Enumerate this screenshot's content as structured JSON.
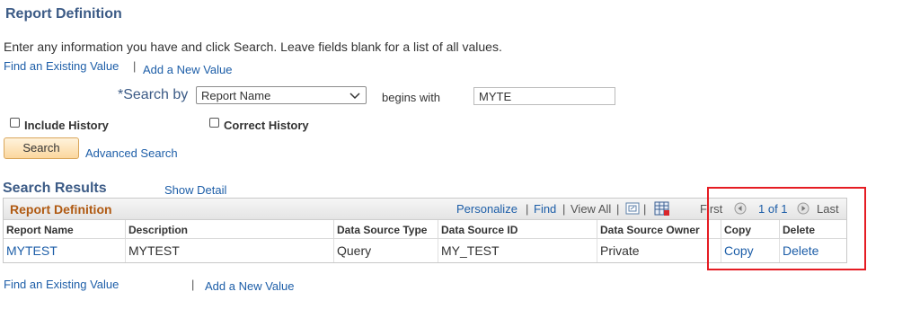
{
  "page": {
    "title": "Report Definition",
    "instructions": "Enter any information you have and click Search. Leave fields blank for a list of all values.",
    "find_existing": "Find an Existing Value",
    "separator": "|",
    "add_new": "Add a New Value"
  },
  "search": {
    "search_by_label": "*Search by",
    "field_selected": "Report Name",
    "operator": "begins with",
    "value": "MYTE",
    "include_history": "Include History",
    "correct_history": "Correct History",
    "search_button": "Search",
    "advanced_search": "Advanced Search"
  },
  "results": {
    "title": "Search Results",
    "show_detail": "Show Detail",
    "grid_title": "Report Definition",
    "personalize": "Personalize",
    "find": "Find",
    "view_all": "View All",
    "first": "First",
    "page_info": "1 of 1",
    "last": "Last",
    "columns": [
      "Report Name",
      "Description",
      "Data Source Type",
      "Data Source ID",
      "Data Source Owner",
      "Copy",
      "Delete"
    ],
    "rows": [
      [
        "MYTEST",
        "MYTEST",
        "Query",
        "MY_TEST",
        "Private",
        "Copy",
        "Delete"
      ]
    ]
  },
  "footer": {
    "find_existing": "Find an Existing Value",
    "separator": "|",
    "add_new": "Add a New Value"
  },
  "colors": {
    "heading": "#3c5b86",
    "link": "#1d5ea8",
    "grid_title": "#b05a12",
    "highlight": "#e51c23"
  }
}
